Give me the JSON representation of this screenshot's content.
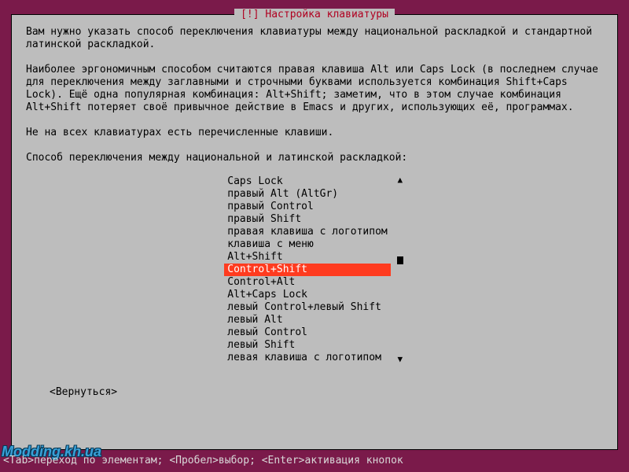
{
  "dialog": {
    "title": "[!] Настройка клавиатуры",
    "para1": "Вам нужно указать способ переключения клавиатуры между национальной раскладкой и стандартной латинской раскладкой.",
    "para2": "Наиболее эргономичным способом считаются правая клавиша Alt или Caps Lock (в последнем случае для переключения между заглавными и строчными буквами используется комбинация Shift+Caps Lock). Ещё одна популярная комбинация: Alt+Shift; заметим, что в этом случае комбинация Alt+Shift потеряет своё привычное действие в Emacs и других, использующих её, программах.",
    "para3": "Не на всех клавиатурах есть перечисленные клавиши.",
    "prompt": "Способ переключения между национальной и латинской раскладкой:",
    "options": [
      "Caps Lock",
      "правый Alt (AltGr)",
      "правый Control",
      "правый Shift",
      "правая клавиша с логотипом",
      "клавиша с меню",
      "Alt+Shift",
      "Control+Shift",
      "Control+Alt",
      "Alt+Caps Lock",
      "левый Control+левый Shift",
      "левый Alt",
      "левый Control",
      "левый Shift",
      "левая клавиша с логотипом"
    ],
    "selected_index": 7,
    "back_label": "<Вернуться>"
  },
  "footer": "<Tab>переход по элементам; <Пробел>выбор; <Enter>активация кнопок",
  "watermark": "Modding.kh.ua"
}
